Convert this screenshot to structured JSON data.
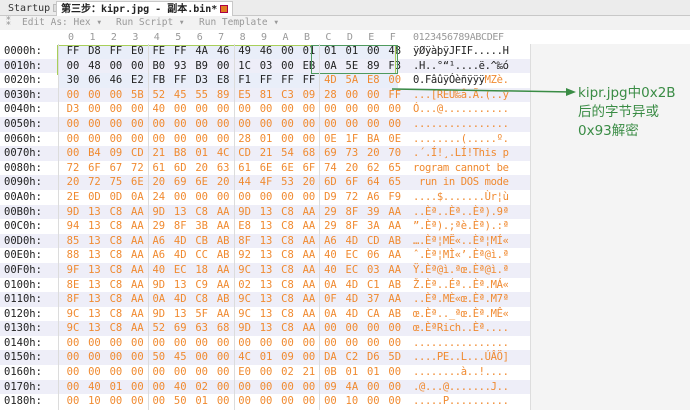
{
  "tabs": [
    {
      "label": "Startup"
    },
    {
      "label": "第三步：kipr.jpg - 副本.bin*"
    }
  ],
  "toolbar": {
    "edit_as": "Edit As: Hex ▾",
    "run_script": "Run Script ▾",
    "run_template": "Run Template ▾"
  },
  "column_headers": [
    "0",
    "1",
    "2",
    "3",
    "4",
    "5",
    "6",
    "7",
    "8",
    "9",
    "A",
    "B",
    "C",
    "D",
    "E",
    "F"
  ],
  "ascii_header": "0123456789ABCDEF",
  "rows": [
    {
      "offset": "0000h:",
      "hex": "FF D8 FF E0 FE FF 4A 46 49 46 00 01 01 01 00 48",
      "ascii": "ÿØÿàþÿJFIF.....H"
    },
    {
      "offset": "0010h:",
      "hex": "00 48 00 00 B0 93 B9 00 1C 03 00 EB 0A 5E 89 F3",
      "ascii": ".H..°“¹....ë.^‰ó"
    },
    {
      "offset": "0020h:",
      "hex": "30 06 46 E2 FB FF D3 E8 F1 FF FF FF 4D 5A E8 00",
      "ascii": "0.FâûÿÓèñÿÿÿMZè."
    },
    {
      "offset": "0030h:",
      "hex": "00 00 00 5B 52 45 55 89 E5 81 C3 09 28 00 00 FF",
      "ascii": "...[REU‰å.Ã.(..ÿ"
    },
    {
      "offset": "0040h:",
      "hex": "D3 00 00 00 40 00 00 00 00 00 00 00 00 00 00 00",
      "ascii": "Ó...@..........."
    },
    {
      "offset": "0050h:",
      "hex": "00 00 00 00 00 00 00 00 00 00 00 00 00 00 00 00",
      "ascii": "................"
    },
    {
      "offset": "0060h:",
      "hex": "00 00 00 00 00 00 00 00 28 01 00 00 0E 1F BA 0E",
      "ascii": "........(.....º."
    },
    {
      "offset": "0070h:",
      "hex": "00 B4 09 CD 21 B8 01 4C CD 21 54 68 69 73 20 70",
      "ascii": ".´.Í!¸.LÍ!This p"
    },
    {
      "offset": "0080h:",
      "hex": "72 6F 67 72 61 6D 20 63 61 6E 6E 6F 74 20 62 65",
      "ascii": "rogram cannot be"
    },
    {
      "offset": "0090h:",
      "hex": "20 72 75 6E 20 69 6E 20 44 4F 53 20 6D 6F 64 65",
      "ascii": " run in DOS mode"
    },
    {
      "offset": "00A0h:",
      "hex": "2E 0D 0D 0A 24 00 00 00 00 00 00 00 D9 72 A6 F9",
      "ascii": "....$.......Ùr¦ù"
    },
    {
      "offset": "00B0h:",
      "hex": "9D 13 C8 AA 9D 13 C8 AA 9D 13 C8 AA 29 8F 39 AA",
      "ascii": "..Èª..Èª..Èª).9ª"
    },
    {
      "offset": "00C0h:",
      "hex": "94 13 C8 AA 29 8F 3B AA E8 13 C8 AA 29 8F 3A AA",
      "ascii": "”.Èª).;ªè.Èª).:ª"
    },
    {
      "offset": "00D0h:",
      "hex": "85 13 C8 AA A6 4D CB AB 8F 13 C8 AA A6 4D CD AB",
      "ascii": "….Èª¦MË«..Èª¦MÍ«"
    },
    {
      "offset": "00E0h:",
      "hex": "88 13 C8 AA A6 4D CC AB 92 13 C8 AA 40 EC 06 AA",
      "ascii": "ˆ.Èª¦MÌ«’.Èª@ì.ª"
    },
    {
      "offset": "00F0h:",
      "hex": "9F 13 C8 AA 40 EC 18 AA 9C 13 C8 AA 40 EC 03 AA",
      "ascii": "Ÿ.Èª@ì.ªœ.Èª@ì.ª"
    },
    {
      "offset": "0100h:",
      "hex": "8E 13 C8 AA 9D 13 C9 AA 02 13 C8 AA 0A 4D C1 AB",
      "ascii": "Ž.Èª..Éª..Èª.MÁ«"
    },
    {
      "offset": "0110h:",
      "hex": "8F 13 C8 AA 0A 4D C8 AB 9C 13 C8 AA 0F 4D 37 AA",
      "ascii": "..Èª.MÈ«œ.Èª.M7ª"
    },
    {
      "offset": "0120h:",
      "hex": "9C 13 C8 AA 9D 13 5F AA 9C 13 C8 AA 0A 4D CA AB",
      "ascii": "œ.Èª.._ªœ.Èª.MÊ«"
    },
    {
      "offset": "0130h:",
      "hex": "9C 13 C8 AA 52 69 63 68 9D 13 C8 AA 00 00 00 00",
      "ascii": "œ.ÈªRich..Èª...."
    },
    {
      "offset": "0140h:",
      "hex": "00 00 00 00 00 00 00 00 00 00 00 00 00 00 00 00",
      "ascii": "................"
    },
    {
      "offset": "0150h:",
      "hex": "00 00 00 00 50 45 00 00 4C 01 09 00 DA C2 D6 5D",
      "ascii": "....PE..L...ÚÂÖ]"
    },
    {
      "offset": "0160h:",
      "hex": "00 00 00 00 00 00 00 00 E0 00 02 21 0B 01 01 00",
      "ascii": "........à..!...."
    },
    {
      "offset": "0170h:",
      "hex": "00 40 01 00 00 40 02 00 00 00 00 00 09 4A 00 00",
      "ascii": ".@...@.......J.."
    },
    {
      "offset": "0180h:",
      "hex": "00 10 00 00 00 50 01 00 00 00 00 00 00 10 00 00",
      "ascii": ".....P.........."
    }
  ],
  "annotation": "kipr.jpg中0x2B后的字节异或0x93解密",
  "colors": {
    "accent_orange": "#f08a30",
    "annotation_green": "#3a8c45",
    "highlight_green": "#a8cf5a"
  }
}
